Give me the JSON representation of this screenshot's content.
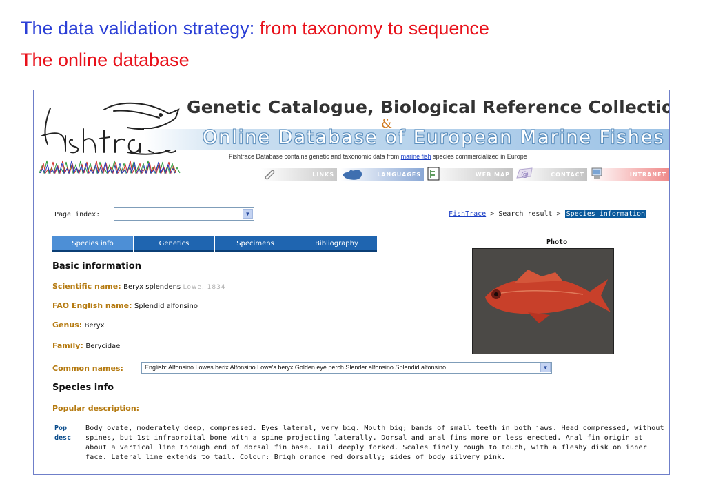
{
  "slide": {
    "title_part1": "The data validation strategy: ",
    "title_part2": "from taxonomy to sequence",
    "subtitle": "The online database",
    "colors": {
      "blue": "#2b3fd6",
      "red": "#e8101a"
    }
  },
  "header": {
    "catalogue_title": "Genetic Catalogue, Biological Reference Collections",
    "ampersand": "&",
    "database_title": "Online Database of European Marine Fishes",
    "description_before": "Fishtrace Database contains genetic and taxonomic data from ",
    "description_link": "marine fish",
    "description_after": " species commercialized in Europe"
  },
  "nav": {
    "links": "LINKS",
    "languages": "LANGUAGES",
    "web_map": "WEB MAP",
    "contact": "CONTACT",
    "intranet": "INTRANET"
  },
  "page_index": {
    "label": "Page index:",
    "value": ""
  },
  "breadcrumb": {
    "root": "FishTrace",
    "sep1": " > ",
    "middle": "Search result",
    "sep2": " > ",
    "current": "Species information"
  },
  "tabs": [
    {
      "label": "Species info",
      "active": true
    },
    {
      "label": "Genetics",
      "active": false
    },
    {
      "label": "Specimens",
      "active": false
    },
    {
      "label": "Bibliography",
      "active": false
    }
  ],
  "basic_info": {
    "heading": "Basic information",
    "scientific_name_label": "Scientific name:",
    "scientific_name": "Beryx splendens",
    "authority": "Lowe, 1834",
    "fao_label": "FAO English name:",
    "fao_name": "Splendid alfonsino",
    "genus_label": "Genus:",
    "genus": "Beryx",
    "family_label": "Family:",
    "family": "Berycidae",
    "common_names_label": "Common names:",
    "common_names_value": "English:   Alfonsino  Lowes berix  Alfonsino  Lowe's beryx  Golden eye perch  Slender alfonsino  Splendid alfonsino"
  },
  "photo": {
    "label": "Photo"
  },
  "species_info": {
    "heading": "Species info",
    "popular_label": "Popular description:",
    "pop_desc_label_1": "Pop",
    "pop_desc_label_2": "desc",
    "pop_desc_text": "Body ovate, moderately deep, compressed. Eyes lateral, very big. Mouth big; bands of small teeth in both jaws. Head compressed, without spines, but 1st infraorbital bone with a spine projecting laterally. Dorsal and anal fins more or less erected. Anal fin origin at about a vertical line through end of dorsal fin base. Tail deeply forked. Scales finely rough to touch, with a fleshy disk on inner face. Lateral line extends to tail. Colour: Brigh orange red dorsally; sides of body silvery pink."
  }
}
